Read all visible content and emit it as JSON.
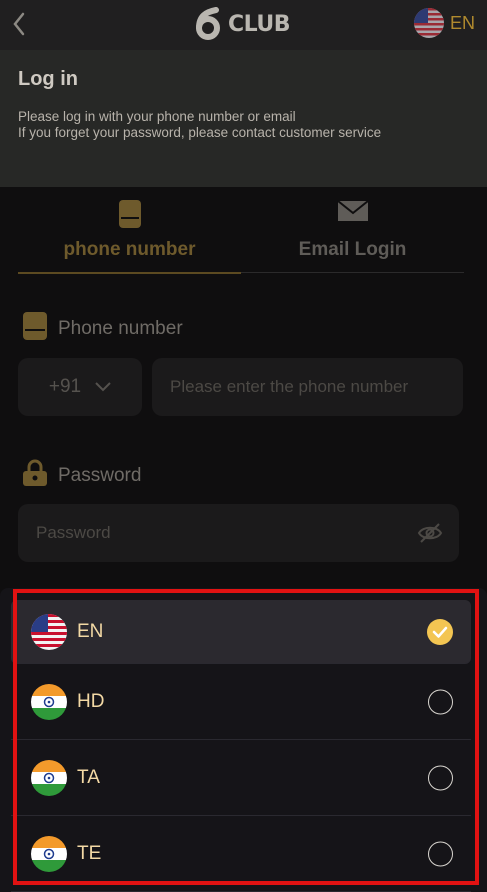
{
  "header": {
    "logo_text": "CLUB",
    "language_code": "EN",
    "back_icon": "chevron-left-icon",
    "flag_icon": "us-flag-icon"
  },
  "login": {
    "title": "Log in",
    "line1": "Please log in with your phone number or email",
    "line2": "If you forget your password, please contact customer service"
  },
  "tabs": [
    {
      "label": "phone number",
      "icon": "phone-icon",
      "active": true
    },
    {
      "label": "Email Login",
      "icon": "mail-icon",
      "active": false
    }
  ],
  "phone": {
    "label": "Phone number",
    "country_code": "+91",
    "placeholder": "Please enter the phone number"
  },
  "password": {
    "label": "Password",
    "placeholder": "Password"
  },
  "languages": [
    {
      "code": "EN",
      "flag": "us-flag-icon",
      "selected": true
    },
    {
      "code": "HD",
      "flag": "india-flag-icon",
      "selected": false
    },
    {
      "code": "TA",
      "flag": "india-flag-icon",
      "selected": false
    },
    {
      "code": "TE",
      "flag": "india-flag-icon",
      "selected": false
    }
  ],
  "colors": {
    "accent_gold": "#f3c552",
    "highlight_red": "#e11212"
  }
}
